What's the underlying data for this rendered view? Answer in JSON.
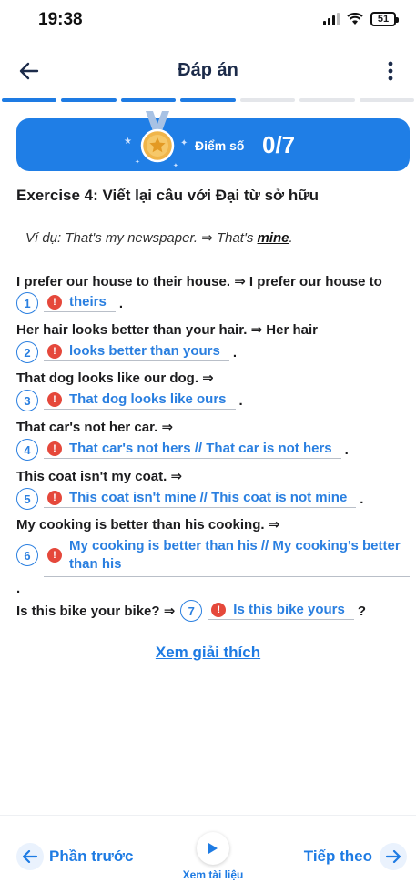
{
  "status_bar": {
    "time": "19:38",
    "battery": "51"
  },
  "header": {
    "title": "Đáp án"
  },
  "progress": {
    "segments": 7,
    "done": 4
  },
  "score": {
    "label": "Điểm số",
    "value": "0/7"
  },
  "exercise": {
    "title": "Exercise 4: Viết lại câu với Đại từ sở hữu",
    "example_prefix": "Ví dụ: That's my newspaper. ⇒ That's ",
    "example_answer": "mine",
    "example_suffix": "."
  },
  "questions": [
    {
      "number": "1",
      "prompt": "I prefer our house to their house. ⇒ I prefer our house to",
      "answer": "theirs",
      "punct": "."
    },
    {
      "number": "2",
      "prompt": "Her hair looks better than your hair. ⇒ Her hair",
      "answer": "looks better than yours",
      "punct": "."
    },
    {
      "number": "3",
      "prompt": "That dog looks like our dog. ⇒",
      "answer": "That dog looks like ours",
      "punct": "."
    },
    {
      "number": "4",
      "prompt": "That car's not her car. ⇒",
      "answer": "That car's not hers // That car is not hers",
      "punct": "."
    },
    {
      "number": "5",
      "prompt": "This coat isn't my coat. ⇒",
      "answer": "This coat isn't mine // This coat is not mine",
      "punct": "."
    },
    {
      "number": "6",
      "prompt": "My cooking is better than his cooking. ⇒",
      "answer": "My cooking is better than his // My cooking’s better than his",
      "punct": "."
    },
    {
      "number": "7",
      "prompt": "Is this bike your bike? ⇒",
      "answer": "Is this bike yours",
      "punct": "?"
    }
  ],
  "explain_link": "Xem giải thích",
  "bottom_nav": {
    "prev": "Phần trước",
    "docs": "Xem tài liệu",
    "next": "Tiếp theo"
  },
  "colors": {
    "accent": "#1e7be3",
    "error": "#e5483b",
    "text": "#1c1c1e"
  },
  "icons": {
    "back": "arrow-left-icon",
    "more": "more-vertical-icon",
    "medal": "medal-icon",
    "error": "exclamation-icon",
    "play": "play-icon"
  }
}
